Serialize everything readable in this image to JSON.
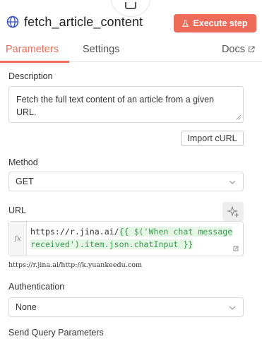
{
  "header": {
    "title": "fetch_article_content",
    "execute_label": "Execute step"
  },
  "tabs": {
    "parameters": "Parameters",
    "settings": "Settings",
    "docs": "Docs"
  },
  "form": {
    "description_label": "Description",
    "description_value": "Fetch the full text content of an article from a given URL.",
    "import_curl_label": "Import cURL",
    "method_label": "Method",
    "method_value": "GET",
    "url_label": "URL",
    "url_prefix": "https://r.jina.ai/",
    "url_expression": "{{ $('When chat message received').item.json.chatInput }}",
    "url_preview": "https://r.jina.ai/http://k.yuankeedu.com",
    "authentication_label": "Authentication",
    "authentication_value": "None",
    "send_query_label": "Send Query Parameters"
  },
  "colors": {
    "accent": "#ee6b5a",
    "expression_green": "#3b9b52",
    "globe_blue": "#3b56c4"
  },
  "icons": {
    "node": "flask-icon",
    "globe": "globe-icon",
    "execute": "flask-icon",
    "docs": "external-link-icon",
    "ai": "sparkle-icon",
    "fx": "fx-icon",
    "expand": "expand-icon",
    "chevron": "chevron-down-icon"
  }
}
